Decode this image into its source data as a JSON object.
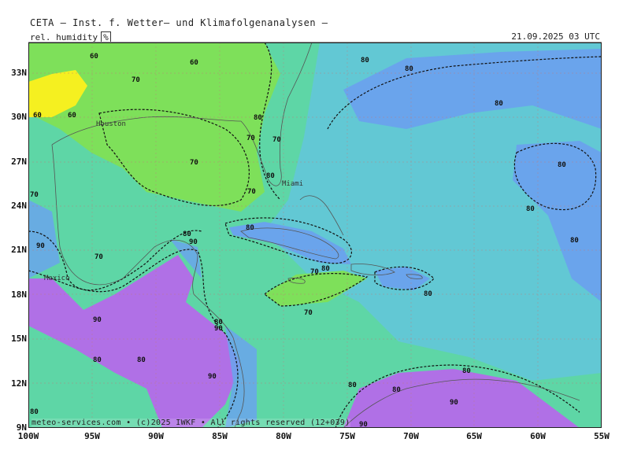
{
  "header": {
    "title": "CETA – Inst. f. Wetter– und Klimafolgenanalysen –",
    "variable": "rel. humidity",
    "unit": "%",
    "datetime": "21.09.2025 03 UTC"
  },
  "axes": {
    "lat_labels": [
      "33N",
      "30N",
      "27N",
      "24N",
      "21N",
      "18N",
      "15N",
      "12N",
      "9N"
    ],
    "lon_labels": [
      "100W",
      "95W",
      "90W",
      "85W",
      "80W",
      "75W",
      "70W",
      "65W",
      "60W",
      "55W"
    ]
  },
  "places": [
    "Houston",
    "Miami",
    "Mexico"
  ],
  "contour_labels": [
    "60",
    "70",
    "80",
    "90"
  ],
  "copyright": "meteo-services.com • (c)2025 IWKF • All rights reserved (12+039)",
  "colors": {
    "very_dry": "#f5f020",
    "dry": "#7ee05a",
    "moderate": "#5ed6a6",
    "humid": "#62c8d4",
    "very_humid": "#6aa4ec",
    "saturated": "#b070e6"
  }
}
